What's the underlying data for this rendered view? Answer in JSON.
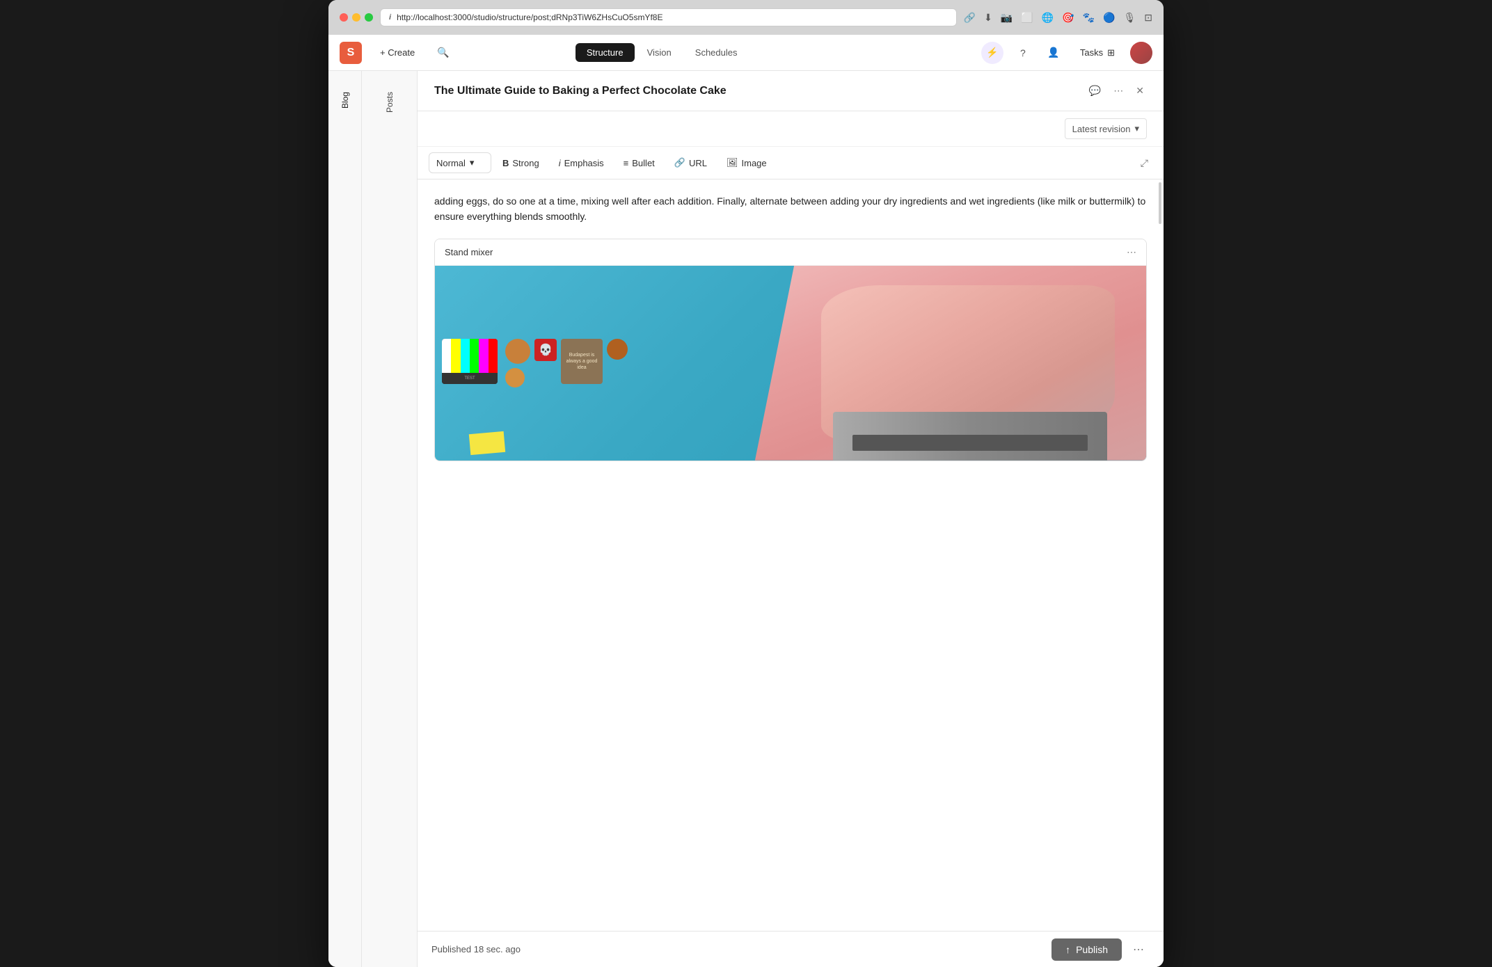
{
  "browser": {
    "url": "http://localhost:3000/studio/structure/post;dRNp3TiW6ZHsCuO5smYf8E",
    "info_icon": "i"
  },
  "app": {
    "logo_letter": "S",
    "create_label": "+ Create",
    "nav_tabs": [
      {
        "id": "structure",
        "label": "Structure",
        "active": true
      },
      {
        "id": "vision",
        "label": "Vision",
        "active": false
      },
      {
        "id": "schedules",
        "label": "Schedules",
        "active": false
      }
    ],
    "header_icons": {
      "lightning": "⚡",
      "help": "?",
      "collaborate": "👤",
      "tasks_label": "Tasks"
    }
  },
  "sidebar": {
    "blog_label": "Blog",
    "posts_label": "Posts"
  },
  "editor": {
    "title": "The Ultimate Guide to Baking a Perfect Chocolate Cake",
    "revision_label": "Latest revision",
    "toolbar": {
      "format_label": "Normal",
      "strong_label": "Strong",
      "emphasis_label": "Emphasis",
      "bullet_label": "Bullet",
      "url_label": "URL",
      "image_label": "Image"
    },
    "content_text": "adding eggs, do so one at a time, mixing well after each addition. Finally, alternate between adding your dry ingredients and wet ingredients (like milk or buttermilk) to ensure everything blends smoothly.",
    "image_block": {
      "title": "Stand mixer",
      "menu_label": "⋯"
    },
    "footer": {
      "status_text": "Published 18 sec. ago",
      "publish_label": "Publish",
      "more_label": "⋯"
    }
  },
  "icons": {
    "comment": "💬",
    "more": "⋯",
    "close": "×",
    "chevron_down": "▾",
    "bold_b": "B",
    "italic_i": "i",
    "bullet": "≡",
    "link": "🔗",
    "image": "🖼",
    "expand": "⤢",
    "upload": "↑",
    "search": "🔍",
    "lightning_purple": "⚡",
    "help_circle": "?",
    "user_icon": "👤",
    "grid": "⊞"
  }
}
